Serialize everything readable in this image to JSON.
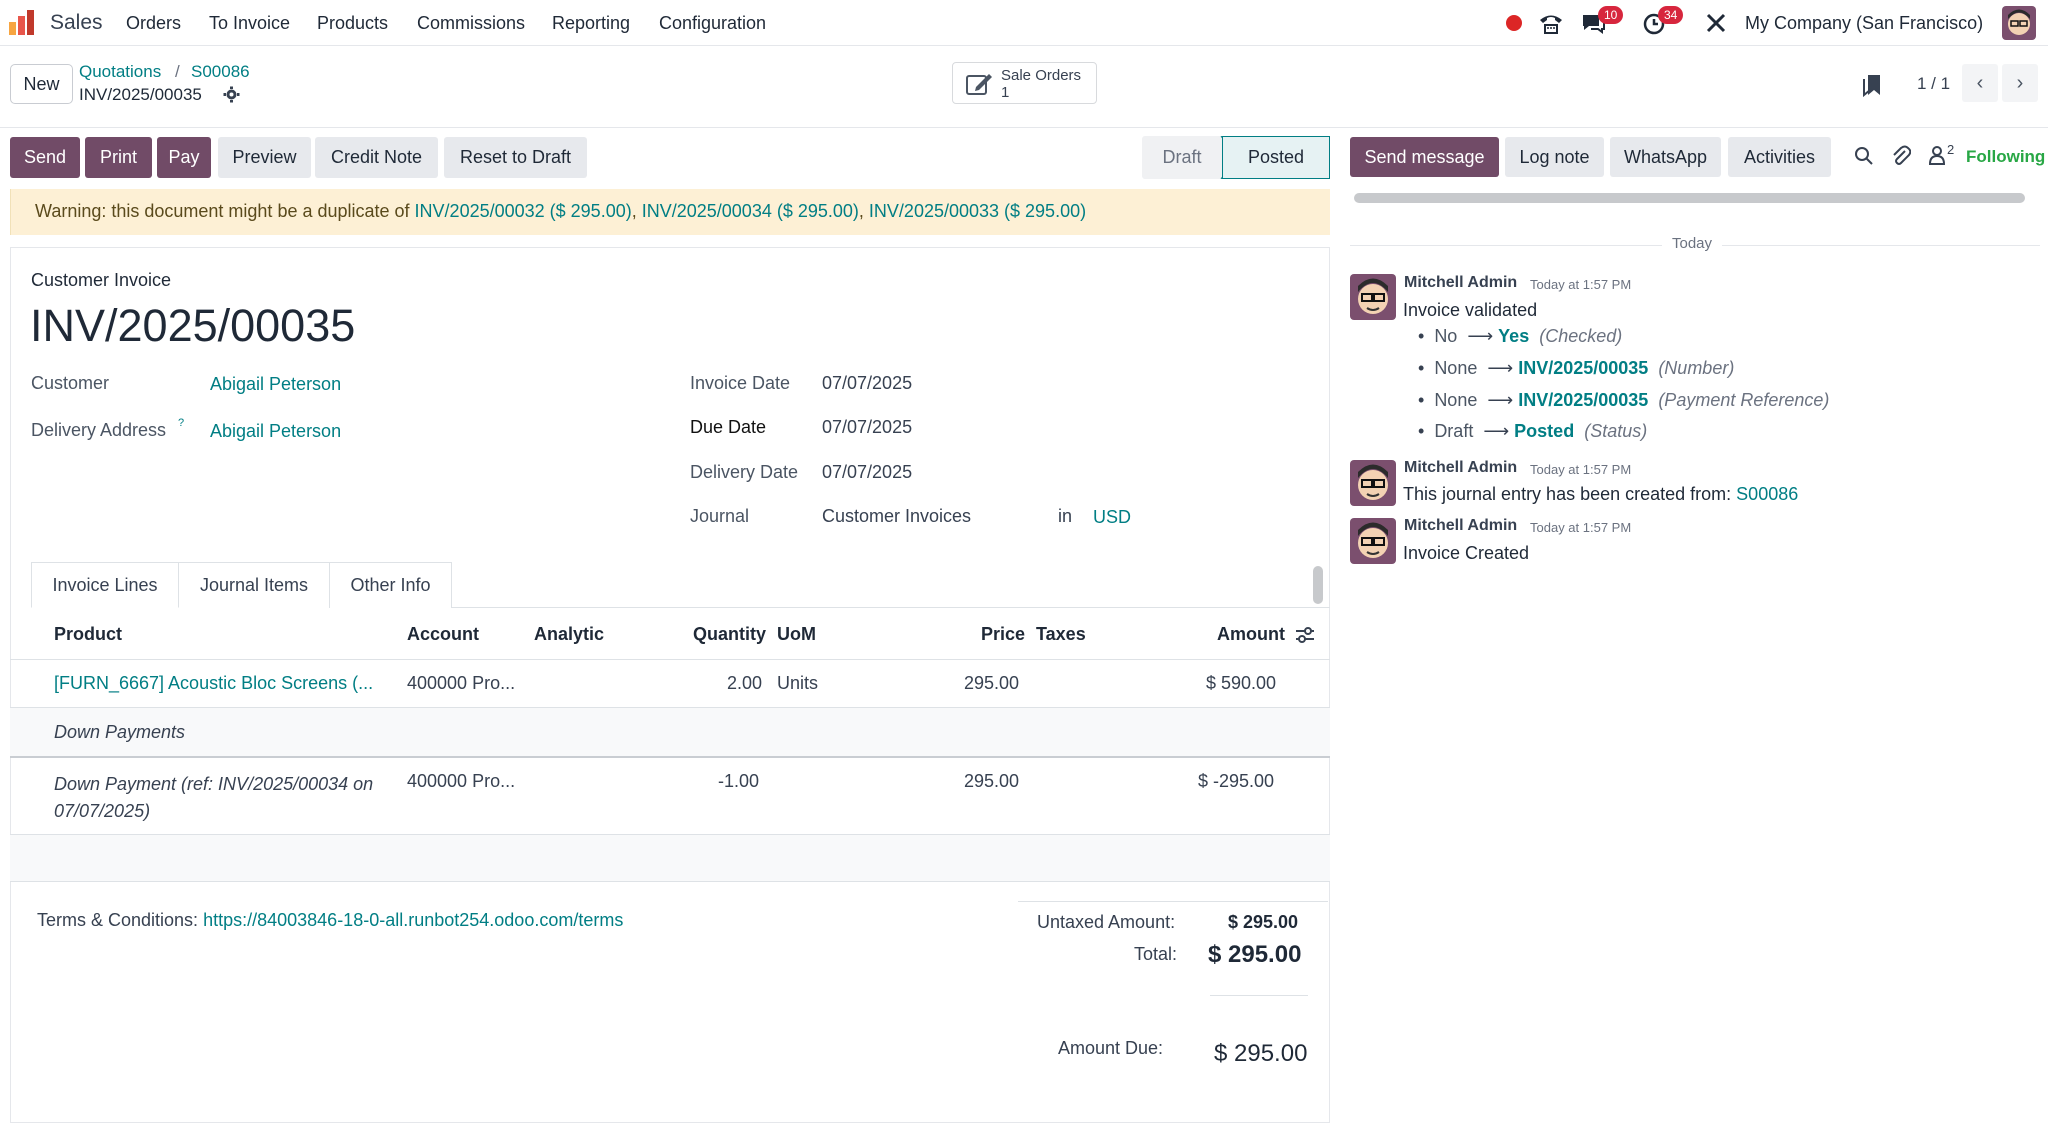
{
  "navbar": {
    "app_name": "Sales",
    "menu": [
      "Orders",
      "To Invoice",
      "Products",
      "Commissions",
      "Reporting",
      "Configuration"
    ],
    "messages_badge": "10",
    "activities_badge": "34",
    "company": "My Company (San Francisco)"
  },
  "control_panel": {
    "new_label": "New",
    "breadcrumb": [
      "Quotations",
      "S00086"
    ],
    "breadcrumb_sep": "/",
    "record_name": "INV/2025/00035",
    "smart_button": {
      "label": "Sale Orders",
      "count": "1"
    },
    "pager": "1 / 1"
  },
  "actions": {
    "send": "Send",
    "print": "Print",
    "pay": "Pay",
    "preview": "Preview",
    "credit_note": "Credit Note",
    "reset_to_draft": "Reset to Draft"
  },
  "status": {
    "draft": "Draft",
    "posted": "Posted",
    "current": "Posted"
  },
  "warning": {
    "prefix": "Warning: this document might be a duplicate of ",
    "links": [
      "INV/2025/00032 ($ 295.00)",
      "INV/2025/00034 ($ 295.00)",
      "INV/2025/00033 ($ 295.00)"
    ],
    "separator": ", "
  },
  "invoice": {
    "type": "Customer Invoice",
    "number": "INV/2025/00035",
    "customer_label": "Customer",
    "customer": "Abigail Peterson",
    "delivery_address_label": "Delivery Address",
    "delivery_address_help": "?",
    "delivery_address": "Abigail Peterson",
    "invoice_date_label": "Invoice Date",
    "invoice_date": "07/07/2025",
    "due_date_label": "Due Date",
    "due_date": "07/07/2025",
    "delivery_date_label": "Delivery Date",
    "delivery_date": "07/07/2025",
    "journal_label": "Journal",
    "journal": "Customer Invoices",
    "in_label": "in",
    "currency": "USD"
  },
  "tabs": [
    "Invoice Lines",
    "Journal Items",
    "Other Info"
  ],
  "lines": {
    "headers": {
      "product": "Product",
      "account": "Account",
      "analytic": "Analytic",
      "quantity": "Quantity",
      "uom": "UoM",
      "price": "Price",
      "taxes": "Taxes",
      "amount": "Amount"
    },
    "row1": {
      "product": "[FURN_6667] Acoustic Bloc Screens (...",
      "account": "400000 Pro...",
      "quantity": "2.00",
      "uom": "Units",
      "price": "295.00",
      "amount": "$ 590.00"
    },
    "section": "Down Payments",
    "row2": {
      "product_line1": "Down Payment (ref: INV/2025/00034 on",
      "product_line2": "07/07/2025)",
      "account": "400000 Pro...",
      "quantity": "-1.00",
      "price": "295.00",
      "amount": "$ -295.00"
    }
  },
  "footer": {
    "terms_label": "Terms & Conditions:",
    "terms_link": "https://84003846-18-0-all.runbot254.odoo.com/terms",
    "untaxed_label": "Untaxed Amount:",
    "untaxed": "$ 295.00",
    "total_label": "Total:",
    "total": "$ 295.00",
    "amount_due_label": "Amount Due:",
    "amount_due": "$ 295.00"
  },
  "chatter": {
    "send_message": "Send message",
    "log_note": "Log note",
    "whatsapp": "WhatsApp",
    "activities": "Activities",
    "followers_count": "2",
    "following": "Following",
    "today": "Today",
    "messages": [
      {
        "author": "Mitchell Admin",
        "time": "Today at 1:57 PM",
        "text": "Invoice validated"
      },
      {
        "author": "Mitchell Admin",
        "time": "Today at 1:57 PM",
        "text": "This journal entry has been created from: ",
        "link": "S00086"
      },
      {
        "author": "Mitchell Admin",
        "time": "Today at 1:57 PM",
        "text": "Invoice Created"
      }
    ],
    "tracking": [
      {
        "old": "No",
        "new": "Yes",
        "field": "(Checked)"
      },
      {
        "old": "None",
        "new": "INV/2025/00035",
        "field": "(Number)"
      },
      {
        "old": "None",
        "new": "INV/2025/00035",
        "field": "(Payment Reference)"
      },
      {
        "old": "Draft",
        "new": "Posted",
        "field": "(Status)"
      }
    ]
  },
  "colors": {
    "primary": "#714b67",
    "link": "#017e84",
    "warning_bg": "#fdf0d5",
    "badge": "#d7263d"
  }
}
